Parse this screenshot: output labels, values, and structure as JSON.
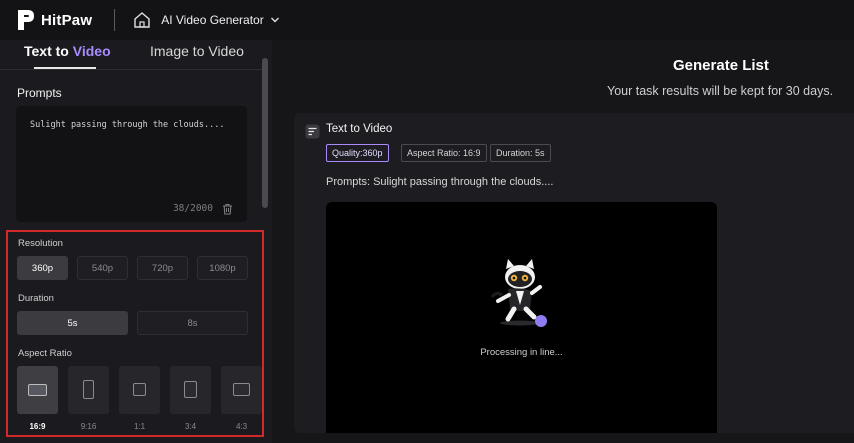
{
  "header": {
    "brand": "HitPaw",
    "tool_name": "AI Video Generator"
  },
  "tabs": {
    "text_to_video_prefix": "Text to ",
    "text_to_video_suffix": "Video",
    "image_to_video": "Image to Video"
  },
  "prompts": {
    "label": "Prompts",
    "text": "Sulight passing through the clouds....",
    "count": "38/2000"
  },
  "resolution": {
    "label": "Resolution",
    "options": [
      "360p",
      "540p",
      "720p",
      "1080p"
    ],
    "selected": "360p"
  },
  "duration": {
    "label": "Duration",
    "options": [
      "5s",
      "8s"
    ],
    "selected": "5s"
  },
  "aspect_ratio": {
    "label": "Aspect Ratio",
    "options": [
      "16:9",
      "9:16",
      "1:1",
      "3:4",
      "4:3"
    ],
    "selected": "16:9"
  },
  "generate_list": {
    "title": "Generate List",
    "subtitle": "Your task results will be kept for 30 days."
  },
  "task": {
    "title": "Text to Video",
    "tags": {
      "quality": "Quality:360p",
      "aspect": "Aspect Ratio: 16:9",
      "duration": "Duration: 5s"
    },
    "prompt_line": "Prompts:  Sulight passing through the clouds....",
    "status": "Processing in line..."
  },
  "colors": {
    "accent": "#a98bff",
    "highlight_border": "#d22a2a",
    "background": "#161619"
  }
}
